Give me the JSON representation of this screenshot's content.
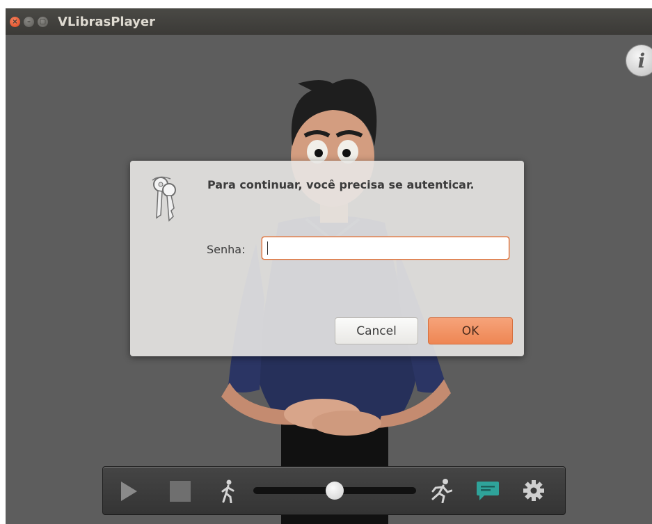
{
  "window": {
    "title": "VLibrasPlayer",
    "controls": [
      "close-icon",
      "minimize-icon",
      "maximize-icon"
    ],
    "close_glyph": "×",
    "min_glyph": "–",
    "max_glyph": "▢"
  },
  "player": {
    "info_glyph": "i",
    "toolbar": {
      "play_icon": "play-icon",
      "stop_icon": "stop-icon",
      "slow_icon": "walking-person-icon",
      "fast_icon": "running-person-icon",
      "subtitles_icon": "speech-bubble-icon",
      "settings_icon": "gear-icon",
      "speed_slider_position": 0.5
    }
  },
  "auth_dialog": {
    "heading": "Para continuar, você precisa se autenticar.",
    "password_label": "Senha:",
    "password_value": "",
    "cancel_label": "Cancel",
    "ok_label": "OK"
  },
  "colors": {
    "accent_orange": "#ee8653",
    "titlebar": "#3c3b37",
    "stage_background": "#5d5d5d",
    "subtitle_icon_teal": "#2fa39a"
  }
}
